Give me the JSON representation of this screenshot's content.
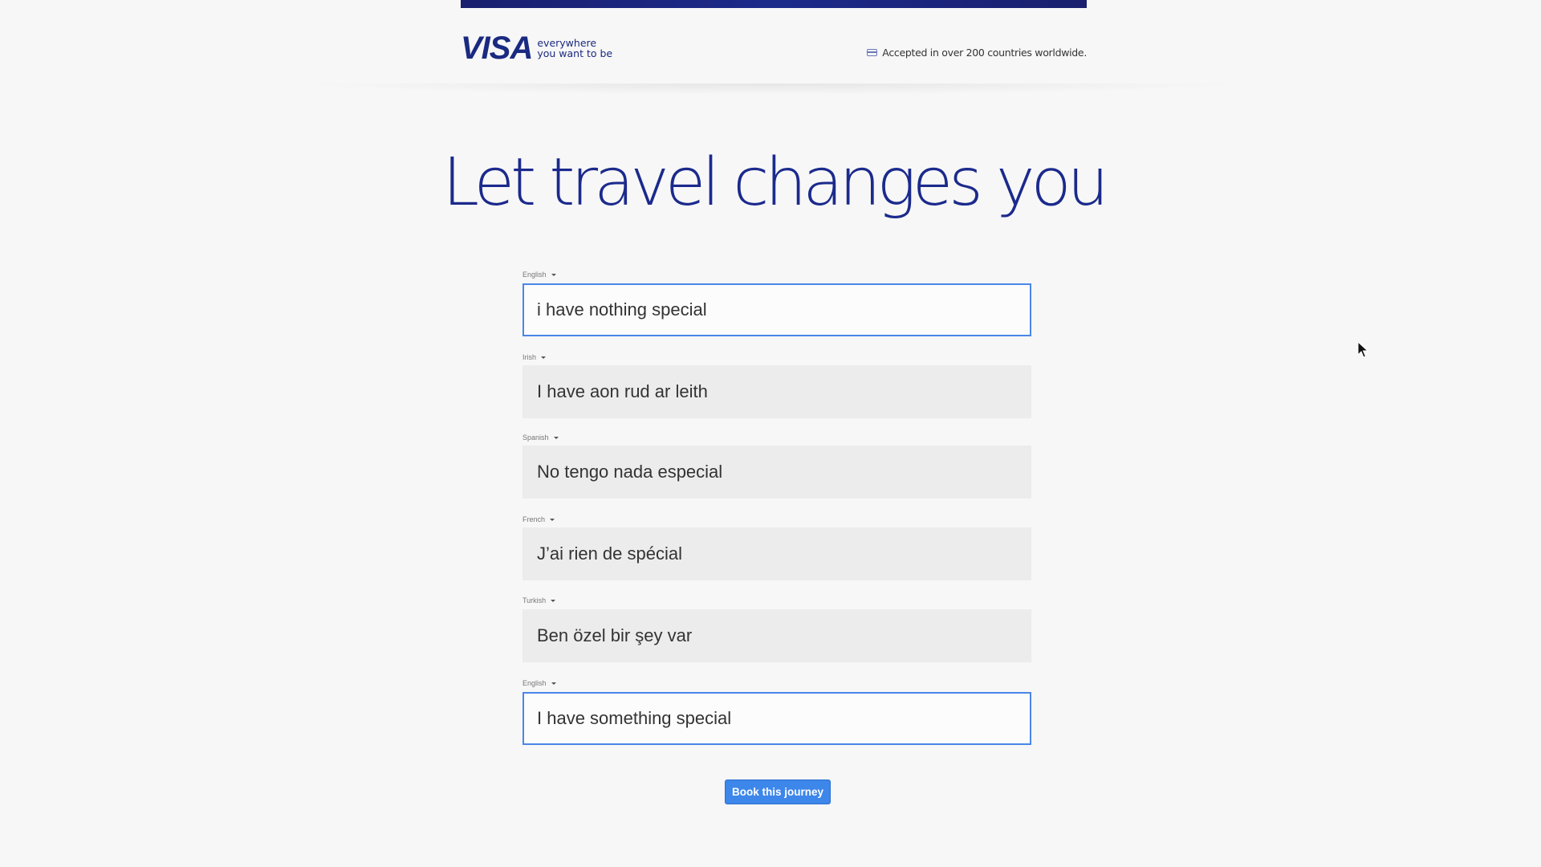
{
  "header": {
    "brand": "VISA",
    "tagline_line1": "everywhere",
    "tagline_line2": "you want to be",
    "accepted_text": "Accepted in over 200 countries worldwide."
  },
  "headline": "Let travel changes you",
  "fields": [
    {
      "language": "English",
      "value": "i have nothing special",
      "state": "active"
    },
    {
      "language": "Irish",
      "value": "I have aon rud ar leith",
      "state": "inactive"
    },
    {
      "language": "Spanish",
      "value": "No tengo nada especial",
      "state": "inactive"
    },
    {
      "language": "French",
      "value": "J’ai rien de spécial",
      "state": "inactive"
    },
    {
      "language": "Turkish",
      "value": "Ben özel bir şey var",
      "state": "inactive"
    },
    {
      "language": "English",
      "value": "I have something special",
      "state": "active"
    }
  ],
  "book_button_label": "Book this journey",
  "colors": {
    "brand_blue": "#1b2a8c",
    "accent_blue": "#3d86ea",
    "field_grey": "#ececec",
    "page_bg": "#f7f7f7"
  }
}
